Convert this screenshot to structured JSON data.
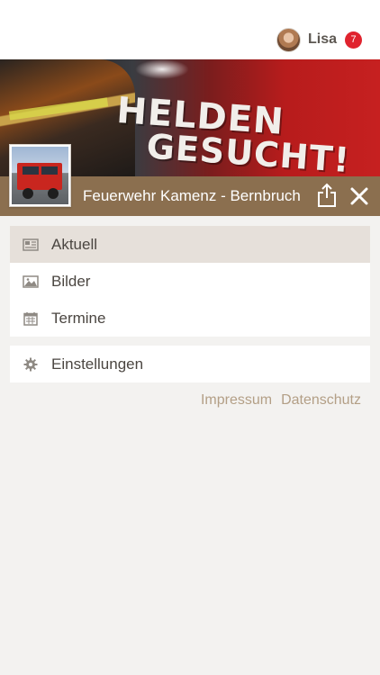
{
  "user": {
    "name": "Lisa",
    "notifications": "7"
  },
  "banner": {
    "line1": "HELDEN",
    "line2": "GESUCHT!"
  },
  "group": {
    "title": "Feuerwehr Kamenz - Bernbruch"
  },
  "menu": {
    "items": [
      {
        "label": "Aktuell",
        "icon": "newspaper-icon",
        "active": true
      },
      {
        "label": "Bilder",
        "icon": "image-icon",
        "active": false
      },
      {
        "label": "Termine",
        "icon": "calendar-icon",
        "active": false
      }
    ],
    "settings": {
      "label": "Einstellungen",
      "icon": "gear-icon"
    }
  },
  "footer": {
    "impressum": "Impressum",
    "datenschutz": "Datenschutz"
  },
  "colors": {
    "brand": "#8b6f4f",
    "badge": "#e0232e",
    "active_bg": "#e6e0da",
    "link": "#b39f86"
  }
}
